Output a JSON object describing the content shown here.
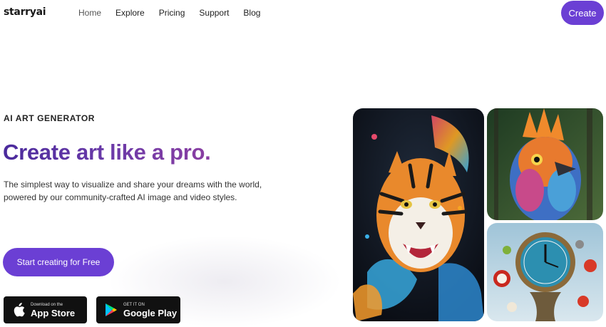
{
  "header": {
    "logo": "starryai",
    "nav": [
      {
        "label": "Home",
        "active": true
      },
      {
        "label": "Explore",
        "active": false
      },
      {
        "label": "Pricing",
        "active": false
      },
      {
        "label": "Support",
        "active": false
      },
      {
        "label": "Blog",
        "active": false
      }
    ],
    "create_label": "Create"
  },
  "hero": {
    "eyebrow": "AI ART GENERATOR",
    "headline": "Create art like a pro.",
    "description": "The simplest way to visualize and share your dreams with the world, powered by our community-crafted AI image and video styles.",
    "cta_label": "Start creating for Free"
  },
  "stores": {
    "apple": {
      "small": "Download on the",
      "big": "App Store",
      "icon": "apple-icon"
    },
    "google": {
      "small": "GET IT ON",
      "big": "Google Play",
      "icon": "google-play-icon"
    }
  },
  "gallery": [
    {
      "name": "tiger-artwork"
    },
    {
      "name": "bird-artwork"
    },
    {
      "name": "clock-artwork"
    }
  ],
  "colors": {
    "accent": "#6b3fd4",
    "headline_gradient_start": "#4a2a9c",
    "headline_gradient_end": "#8a3ea2",
    "store_badge": "#111111"
  }
}
